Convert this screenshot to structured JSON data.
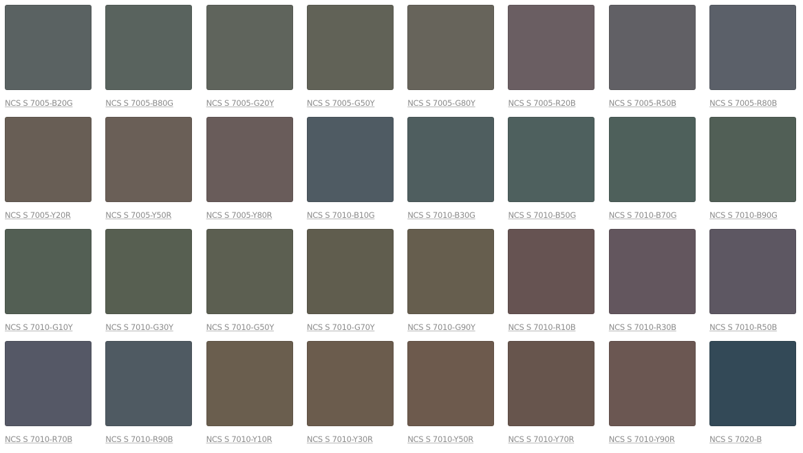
{
  "swatches": [
    {
      "code": "NCS S 7005-B20G",
      "color": "#5a6262"
    },
    {
      "code": "NCS S 7005-B80G",
      "color": "#59635e"
    },
    {
      "code": "NCS S 7005-G20Y",
      "color": "#5f645c"
    },
    {
      "code": "NCS S 7005-G50Y",
      "color": "#616257"
    },
    {
      "code": "NCS S 7005-G80Y",
      "color": "#67645b"
    },
    {
      "code": "NCS S 7005-R20B",
      "color": "#6a5e62"
    },
    {
      "code": "NCS S 7005-R50B",
      "color": "#616065"
    },
    {
      "code": "NCS S 7005-R80B",
      "color": "#5b6069"
    },
    {
      "code": "NCS S 7005-Y20R",
      "color": "#685e55"
    },
    {
      "code": "NCS S 7005-Y50R",
      "color": "#6a5f57"
    },
    {
      "code": "NCS S 7005-Y80R",
      "color": "#695c5a"
    },
    {
      "code": "NCS S 7010-B10G",
      "color": "#4f5b63"
    },
    {
      "code": "NCS S 7010-B30G",
      "color": "#4f5e5f"
    },
    {
      "code": "NCS S 7010-B50G",
      "color": "#4e605e"
    },
    {
      "code": "NCS S 7010-B70G",
      "color": "#4e605b"
    },
    {
      "code": "NCS S 7010-B90G",
      "color": "#515f56"
    },
    {
      "code": "NCS S 7010-G10Y",
      "color": "#535f54"
    },
    {
      "code": "NCS S 7010-G30Y",
      "color": "#575f51"
    },
    {
      "code": "NCS S 7010-G50Y",
      "color": "#5c5f51"
    },
    {
      "code": "NCS S 7010-G70Y",
      "color": "#605d4e"
    },
    {
      "code": "NCS S 7010-G90Y",
      "color": "#665e4e"
    },
    {
      "code": "NCS S 7010-R10B",
      "color": "#665352"
    },
    {
      "code": "NCS S 7010-R30B",
      "color": "#63565e"
    },
    {
      "code": "NCS S 7010-R50B",
      "color": "#5d5762"
    },
    {
      "code": "NCS S 7010-R70B",
      "color": "#555866"
    },
    {
      "code": "NCS S 7010-R90B",
      "color": "#4f5a62"
    },
    {
      "code": "NCS S 7010-Y10R",
      "color": "#6a5e4e"
    },
    {
      "code": "NCS S 7010-Y30R",
      "color": "#6b5c4d"
    },
    {
      "code": "NCS S 7010-Y50R",
      "color": "#6d5a4d"
    },
    {
      "code": "NCS S 7010-Y70R",
      "color": "#67554d"
    },
    {
      "code": "NCS S 7010-Y90R",
      "color": "#6b5752"
    },
    {
      "code": "NCS S 7020-B",
      "color": "#334957"
    }
  ]
}
